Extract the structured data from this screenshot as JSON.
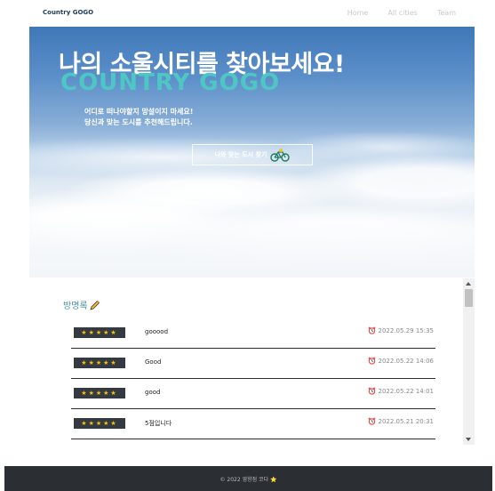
{
  "nav": {
    "brand": "Country GOGO",
    "links": [
      "Home",
      "All cities",
      "Team"
    ]
  },
  "hero": {
    "title": "나의 소울시티를 찾아보세요!",
    "brand": "COUNTRY GOGO",
    "subtitle_line1": "어디로 떠나야할지 망설이지 마세요!",
    "subtitle_line2": "당신과 맞는 도시를 추천해드립니다.",
    "cta_label": "나와 맞는 도시 찾기"
  },
  "guestbook": {
    "title": "방명록",
    "entries": [
      {
        "stars": "★★★★★",
        "message": "gooood",
        "date": "2022.05.29 15:35"
      },
      {
        "stars": "★★★★★",
        "message": "Good",
        "date": "2022.05.22 14:06"
      },
      {
        "stars": "★★★★★",
        "message": "good",
        "date": "2022.05.22 14:01"
      },
      {
        "stars": "★★★★★",
        "message": "5점입니다",
        "date": "2022.05.21 20:31"
      }
    ]
  },
  "footer": {
    "text": "© 2022 영향점 코다 ⭐"
  },
  "colors": {
    "accent": "#4ec7c4",
    "footer_bg": "#2b2f33",
    "star_badge_bg": "#343a40",
    "star": "#f6c10f"
  },
  "icons": {
    "pencil": "pencil-icon",
    "alarm_clock": "alarm-clock-icon",
    "bicycle": "bicycle-icon"
  }
}
